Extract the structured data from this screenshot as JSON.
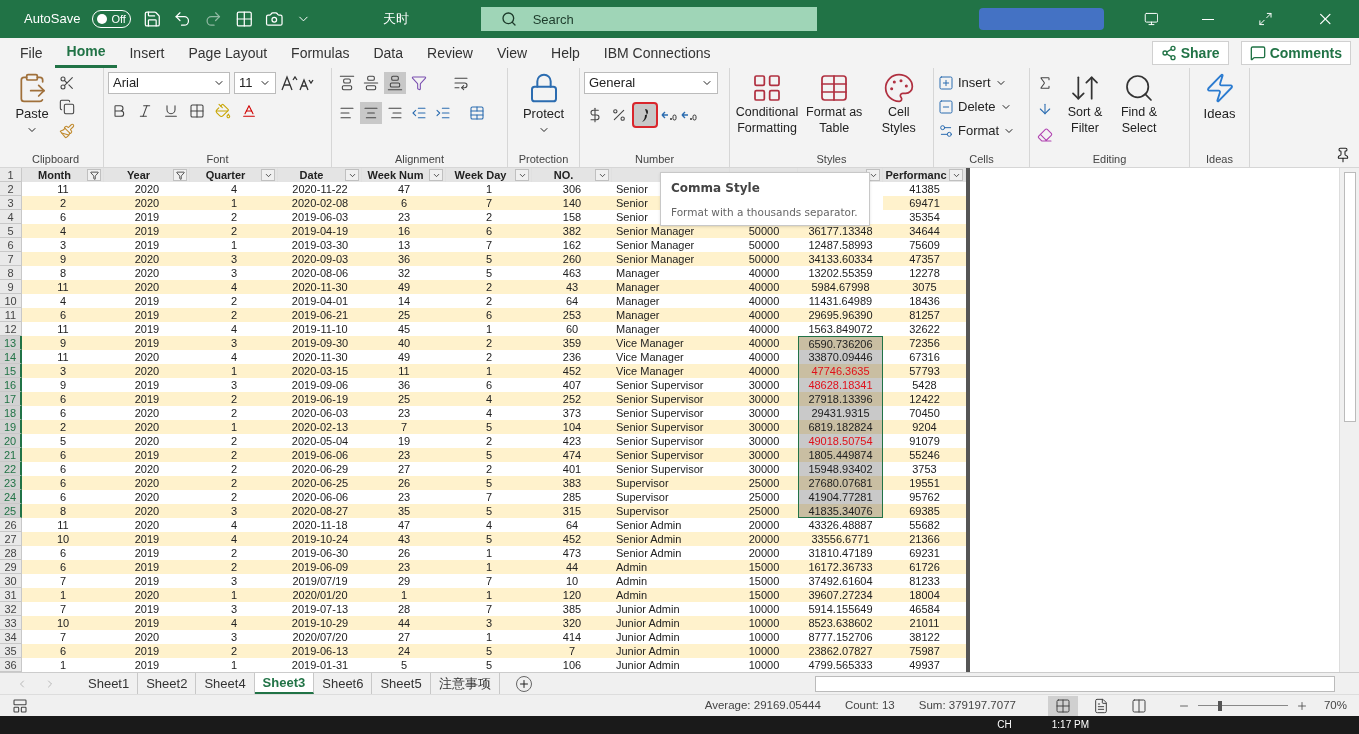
{
  "title_bar": {
    "autosave_label": "AutoSave",
    "autosave_on": false,
    "autosave_state": "Off",
    "file_name": "天时",
    "search_placeholder": "Search"
  },
  "ribbon_tabs": [
    {
      "label": "File",
      "selected": false
    },
    {
      "label": "Home",
      "selected": true
    },
    {
      "label": "Insert",
      "selected": false
    },
    {
      "label": "Page Layout",
      "selected": false
    },
    {
      "label": "Formulas",
      "selected": false
    },
    {
      "label": "Data",
      "selected": false
    },
    {
      "label": "Review",
      "selected": false
    },
    {
      "label": "View",
      "selected": false
    },
    {
      "label": "Help",
      "selected": false
    },
    {
      "label": "IBM Connections",
      "selected": false
    }
  ],
  "share": "Share",
  "comments": "Comments",
  "clipboard": {
    "label": "Clipboard",
    "paste": "Paste"
  },
  "font": {
    "label": "Font",
    "font_name": "Arial",
    "font_size": "11"
  },
  "alignment": {
    "label": "Alignment",
    "vertical": [
      {
        "kind": "top",
        "pressed": false
      },
      {
        "kind": "middle",
        "pressed": false
      },
      {
        "kind": "bottom",
        "pressed": true
      }
    ],
    "horizontal": [
      {
        "kind": "left",
        "pressed": false
      },
      {
        "kind": "center",
        "pressed": true
      },
      {
        "kind": "right",
        "pressed": false
      }
    ]
  },
  "protection": {
    "label": "Protection",
    "protect": "Protect"
  },
  "number": {
    "label": "Number",
    "format": "General",
    "comma_selected": true
  },
  "styles": {
    "label": "Styles",
    "buttons": [
      "Conditional Formatting",
      "Format as Table",
      "Cell Styles"
    ]
  },
  "cells": {
    "label": "Cells",
    "buttons": [
      "Insert",
      "Delete",
      "Format"
    ]
  },
  "editing": {
    "label": "Editing",
    "buttons": [
      "Sort & Filter",
      "Find & Select"
    ]
  },
  "ideas": {
    "label": "Ideas",
    "button": "Ideas"
  },
  "tooltip": {
    "title": "Comma Style",
    "text": "Format with a thousands separator."
  },
  "header_row_number": "1",
  "columns": [
    {
      "label": "Month",
      "filtered": true
    },
    {
      "label": "Year",
      "filtered": true
    },
    {
      "label": "Quarter",
      "filtered": false
    },
    {
      "label": "Date",
      "filtered": false
    },
    {
      "label": "Week Num",
      "filtered": false
    },
    {
      "label": "Week Day",
      "filtered": false
    },
    {
      "label": "NO.",
      "filtered": false
    },
    {},
    {},
    {
      "filtered": false
    },
    {
      "label": "Performanc",
      "filtered": false
    }
  ],
  "rows": [
    {
      "number": "2",
      "selected": false,
      "cells": [
        "11",
        "2020",
        "4",
        "2020-11-22",
        "47",
        "1",
        "306",
        "Senior",
        null,
        null,
        "41385"
      ]
    },
    {
      "number": "3",
      "selected": false,
      "cells": [
        "2",
        "2020",
        "1",
        "2020-02-08",
        "6",
        "7",
        "140",
        "Senior",
        null,
        null,
        "69471"
      ]
    },
    {
      "number": "4",
      "selected": false,
      "cells": [
        "6",
        "2019",
        "2",
        "2019-06-03",
        "23",
        "2",
        "158",
        "Senior",
        null,
        null,
        "35354"
      ]
    },
    {
      "number": "5",
      "selected": false,
      "red": false,
      "cells": [
        "4",
        "2019",
        "2",
        "2019-04-19",
        "16",
        "6",
        "382",
        "Senior Manager",
        "50000",
        "36177.13348",
        "34644"
      ]
    },
    {
      "number": "6",
      "selected": false,
      "red": false,
      "cells": [
        "3",
        "2019",
        "1",
        "2019-03-30",
        "13",
        "7",
        "162",
        "Senior Manager",
        "50000",
        "12487.58993",
        "75609"
      ]
    },
    {
      "number": "7",
      "selected": false,
      "red": false,
      "cells": [
        "9",
        "2020",
        "3",
        "2020-09-03",
        "36",
        "5",
        "260",
        "Senior Manager",
        "50000",
        "34133.60334",
        "47357"
      ]
    },
    {
      "number": "8",
      "selected": false,
      "red": false,
      "cells": [
        "8",
        "2020",
        "3",
        "2020-08-06",
        "32",
        "5",
        "463",
        "Manager",
        "40000",
        "13202.55359",
        "12278"
      ]
    },
    {
      "number": "9",
      "selected": false,
      "red": false,
      "cells": [
        "11",
        "2020",
        "4",
        "2020-11-30",
        "49",
        "2",
        "43",
        "Manager",
        "40000",
        "5984.67998",
        "3075"
      ]
    },
    {
      "number": "10",
      "selected": false,
      "red": false,
      "cells": [
        "4",
        "2019",
        "2",
        "2019-04-01",
        "14",
        "2",
        "64",
        "Manager",
        "40000",
        "11431.64989",
        "18436"
      ]
    },
    {
      "number": "11",
      "selected": false,
      "red": false,
      "cells": [
        "6",
        "2019",
        "2",
        "2019-06-21",
        "25",
        "6",
        "253",
        "Manager",
        "40000",
        "29695.96390",
        "81257"
      ]
    },
    {
      "number": "12",
      "selected": false,
      "red": false,
      "cells": [
        "11",
        "2019",
        "4",
        "2019-11-10",
        "45",
        "1",
        "60",
        "Manager",
        "40000",
        "1563.849072",
        "32622"
      ]
    },
    {
      "number": "13",
      "selected": true,
      "red": false,
      "cells": [
        "9",
        "2019",
        "3",
        "2019-09-30",
        "40",
        "2",
        "359",
        "Vice Manager",
        "40000",
        "6590.736206",
        "72356"
      ]
    },
    {
      "number": "14",
      "selected": true,
      "red": false,
      "cells": [
        "11",
        "2020",
        "4",
        "2020-11-30",
        "49",
        "2",
        "236",
        "Vice Manager",
        "40000",
        "33870.09446",
        "67316"
      ]
    },
    {
      "number": "15",
      "selected": true,
      "red": true,
      "cells": [
        "3",
        "2020",
        "1",
        "2020-03-15",
        "11",
        "1",
        "452",
        "Vice Manager",
        "40000",
        "47746.3635",
        "57793"
      ]
    },
    {
      "number": "16",
      "selected": true,
      "red": true,
      "cells": [
        "9",
        "2019",
        "3",
        "2019-09-06",
        "36",
        "6",
        "407",
        "Senior Supervisor",
        "30000",
        "48628.18341",
        "5428"
      ]
    },
    {
      "number": "17",
      "selected": true,
      "red": false,
      "cells": [
        "6",
        "2019",
        "2",
        "2019-06-19",
        "25",
        "4",
        "252",
        "Senior Supervisor",
        "30000",
        "27918.13396",
        "12422"
      ]
    },
    {
      "number": "18",
      "selected": true,
      "red": false,
      "cells": [
        "6",
        "2020",
        "2",
        "2020-06-03",
        "23",
        "4",
        "373",
        "Senior Supervisor",
        "30000",
        "29431.9315",
        "70450"
      ]
    },
    {
      "number": "19",
      "selected": true,
      "red": false,
      "cells": [
        "2",
        "2020",
        "1",
        "2020-02-13",
        "7",
        "5",
        "104",
        "Senior Supervisor",
        "30000",
        "6819.182824",
        "9204"
      ]
    },
    {
      "number": "20",
      "selected": true,
      "red": true,
      "cells": [
        "5",
        "2020",
        "2",
        "2020-05-04",
        "19",
        "2",
        "423",
        "Senior Supervisor",
        "30000",
        "49018.50754",
        "91079"
      ]
    },
    {
      "number": "21",
      "selected": true,
      "red": false,
      "cells": [
        "6",
        "2019",
        "2",
        "2019-06-06",
        "23",
        "5",
        "474",
        "Senior Supervisor",
        "30000",
        "1805.449874",
        "55246"
      ]
    },
    {
      "number": "22",
      "selected": true,
      "red": false,
      "cells": [
        "6",
        "2020",
        "2",
        "2020-06-29",
        "27",
        "2",
        "401",
        "Senior Supervisor",
        "30000",
        "15948.93402",
        "3753"
      ]
    },
    {
      "number": "23",
      "selected": true,
      "red": false,
      "cells": [
        "6",
        "2020",
        "2",
        "2020-06-25",
        "26",
        "5",
        "383",
        "Supervisor",
        "25000",
        "27680.07681",
        "19551"
      ]
    },
    {
      "number": "24",
      "selected": true,
      "red": false,
      "cells": [
        "6",
        "2020",
        "2",
        "2020-06-06",
        "23",
        "7",
        "285",
        "Supervisor",
        "25000",
        "41904.77281",
        "95762"
      ]
    },
    {
      "number": "25",
      "selected": true,
      "red": false,
      "cells": [
        "8",
        "2020",
        "3",
        "2020-08-27",
        "35",
        "5",
        "315",
        "Supervisor",
        "25000",
        "41835.34076",
        "69385"
      ]
    },
    {
      "number": "26",
      "selected": false,
      "red": false,
      "cells": [
        "11",
        "2020",
        "4",
        "2020-11-18",
        "47",
        "4",
        "64",
        "Senior Admin",
        "20000",
        "43326.48887",
        "55682"
      ]
    },
    {
      "number": "27",
      "selected": false,
      "red": false,
      "cells": [
        "10",
        "2019",
        "4",
        "2019-10-24",
        "43",
        "5",
        "452",
        "Senior Admin",
        "20000",
        "33556.6771",
        "21366"
      ]
    },
    {
      "number": "28",
      "selected": false,
      "red": false,
      "cells": [
        "6",
        "2019",
        "2",
        "2019-06-30",
        "26",
        "1",
        "473",
        "Senior Admin",
        "20000",
        "31810.47189",
        "69231"
      ]
    },
    {
      "number": "29",
      "selected": false,
      "red": false,
      "cells": [
        "6",
        "2019",
        "2",
        "2019-06-09",
        "23",
        "1",
        "44",
        "Admin",
        "15000",
        "16172.36733",
        "61726"
      ]
    },
    {
      "number": "30",
      "selected": false,
      "red": false,
      "cells": [
        "7",
        "2019",
        "3",
        "2019/07/19",
        "29",
        "7",
        "10",
        "Admin",
        "15000",
        "37492.61604",
        "81233"
      ]
    },
    {
      "number": "31",
      "selected": false,
      "red": false,
      "cells": [
        "1",
        "2020",
        "1",
        "2020/01/20",
        "1",
        "1",
        "120",
        "Admin",
        "15000",
        "39607.27234",
        "18004"
      ]
    },
    {
      "number": "32",
      "selected": false,
      "red": false,
      "cells": [
        "7",
        "2019",
        "3",
        "2019-07-13",
        "28",
        "7",
        "385",
        "Junior Admin",
        "10000",
        "5914.155649",
        "46584"
      ]
    },
    {
      "number": "33",
      "selected": false,
      "red": false,
      "cells": [
        "10",
        "2019",
        "4",
        "2019-10-29",
        "44",
        "3",
        "320",
        "Junior Admin",
        "10000",
        "8523.638602",
        "21011"
      ]
    },
    {
      "number": "34",
      "selected": false,
      "red": false,
      "cells": [
        "7",
        "2020",
        "3",
        "2020/07/20",
        "27",
        "1",
        "414",
        "Junior Admin",
        "10000",
        "8777.152706",
        "38122"
      ]
    },
    {
      "number": "35",
      "selected": false,
      "red": false,
      "cells": [
        "6",
        "2019",
        "2",
        "2019-06-13",
        "24",
        "5",
        "7",
        "Junior Admin",
        "10000",
        "23862.07827",
        "75987"
      ]
    },
    {
      "number": "36",
      "selected": false,
      "red": false,
      "cells": [
        "1",
        "2019",
        "1",
        "2019-01-31",
        "5",
        "5",
        "106",
        "Junior Admin",
        "10000",
        "4799.565333",
        "49937"
      ]
    }
  ],
  "sheet_tabs": [
    {
      "label": "Sheet1",
      "selected": false
    },
    {
      "label": "Sheet2",
      "selected": false
    },
    {
      "label": "Sheet4",
      "selected": false
    },
    {
      "label": "Sheet3",
      "selected": true
    },
    {
      "label": "Sheet6",
      "selected": false
    },
    {
      "label": "Sheet5",
      "selected": false
    },
    {
      "label": "注意事项",
      "selected": false
    }
  ],
  "status": {
    "average": "Average: 29169.05444",
    "count": "Count: 13",
    "sum": "Sum: 379197.7077",
    "views": [
      {
        "kind": "normal",
        "selected": true
      },
      {
        "kind": "page_layout",
        "selected": false
      },
      {
        "kind": "page_break",
        "selected": false
      }
    ],
    "zoom_slider": {
      "level": 0.25
    },
    "zoom": "70%"
  },
  "taskbar": {
    "language": "CH",
    "time": "1:17 PM"
  }
}
